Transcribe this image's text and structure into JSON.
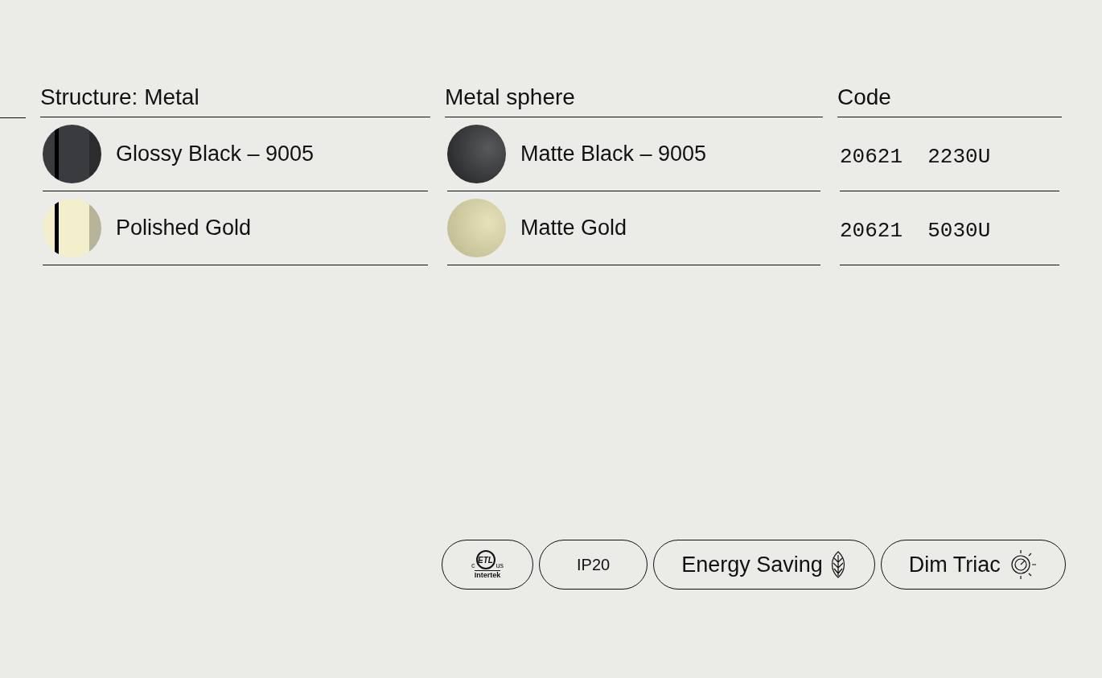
{
  "columns": [
    {
      "header": "Structure: Metal",
      "kind": "swatch",
      "rows": [
        {
          "label": "Glossy Black – 9005",
          "kind": "glossy",
          "color": "#3a3b3e"
        },
        {
          "label": "Polished Gold",
          "kind": "glossy",
          "color": "#f3efcc"
        }
      ]
    },
    {
      "header": "Metal sphere",
      "kind": "swatch",
      "rows": [
        {
          "label": "Matte Black – 9005",
          "kind": "matte",
          "color": "#333436"
        },
        {
          "label": "Matte Gold",
          "kind": "matte",
          "color": "#e2dbac"
        }
      ]
    },
    {
      "header": "Code",
      "kind": "code",
      "rows": [
        {
          "label": "20621  2230U"
        },
        {
          "label": "20621  5030U"
        }
      ]
    }
  ],
  "badges": [
    {
      "kind": "logo",
      "left": "c",
      "mark": "ETL",
      "right": "us",
      "caption": "Intertek"
    },
    {
      "kind": "text",
      "label": "IP20"
    },
    {
      "kind": "leaf",
      "label": "Energy Saving"
    },
    {
      "kind": "dial",
      "label": "Dim Triac"
    }
  ]
}
